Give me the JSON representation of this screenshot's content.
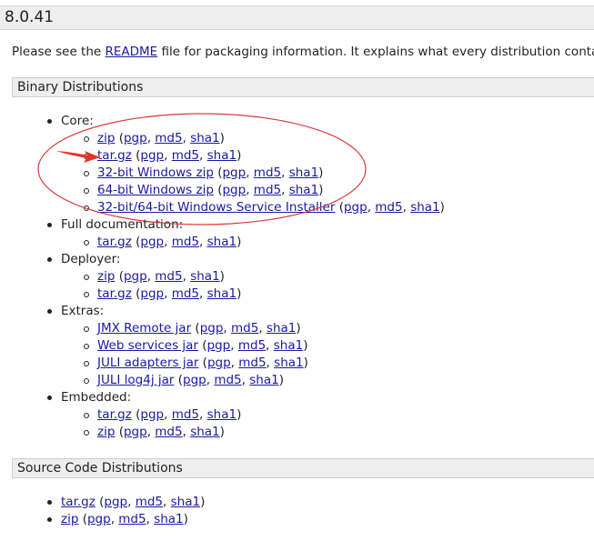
{
  "version": "8.0.41",
  "intro": {
    "before": "Please see the ",
    "link": "README",
    "after": " file for packaging information. It explains what every distribution contains."
  },
  "binary": {
    "title": "Binary Distributions",
    "core": {
      "label": "Core:",
      "items": [
        {
          "name": "zip",
          "sigs": [
            "pgp",
            "md5",
            "sha1"
          ]
        },
        {
          "name": "tar.gz",
          "sigs": [
            "pgp",
            "md5",
            "sha1"
          ]
        },
        {
          "name": "32-bit Windows zip",
          "sigs": [
            "pgp",
            "md5",
            "sha1"
          ]
        },
        {
          "name": "64-bit Windows zip",
          "sigs": [
            "pgp",
            "md5",
            "sha1"
          ]
        },
        {
          "name": "32-bit/64-bit Windows Service Installer",
          "sigs": [
            "pgp",
            "md5",
            "sha1"
          ]
        }
      ]
    },
    "fulldoc": {
      "label": "Full documentation:",
      "items": [
        {
          "name": "tar.gz",
          "sigs": [
            "pgp",
            "md5",
            "sha1"
          ]
        }
      ]
    },
    "deployer": {
      "label": "Deployer:",
      "items": [
        {
          "name": "zip",
          "sigs": [
            "pgp",
            "md5",
            "sha1"
          ]
        },
        {
          "name": "tar.gz",
          "sigs": [
            "pgp",
            "md5",
            "sha1"
          ]
        }
      ]
    },
    "extras": {
      "label": "Extras:",
      "items": [
        {
          "name": "JMX Remote jar",
          "sigs": [
            "pgp",
            "md5",
            "sha1"
          ]
        },
        {
          "name": "Web services jar",
          "sigs": [
            "pgp",
            "md5",
            "sha1"
          ]
        },
        {
          "name": "JULI adapters jar",
          "sigs": [
            "pgp",
            "md5",
            "sha1"
          ]
        },
        {
          "name": "JULI log4j jar",
          "sigs": [
            "pgp",
            "md5",
            "sha1"
          ]
        }
      ]
    },
    "embedded": {
      "label": "Embedded:",
      "items": [
        {
          "name": "tar.gz",
          "sigs": [
            "pgp",
            "md5",
            "sha1"
          ]
        },
        {
          "name": "zip",
          "sigs": [
            "pgp",
            "md5",
            "sha1"
          ]
        }
      ]
    }
  },
  "source": {
    "title": "Source Code Distributions",
    "items": [
      {
        "name": "tar.gz",
        "sigs": [
          "pgp",
          "md5",
          "sha1"
        ]
      },
      {
        "name": "zip",
        "sigs": [
          "pgp",
          "md5",
          "sha1"
        ]
      }
    ]
  },
  "annotation": {
    "stroke_color": "#d83a3a",
    "arrow_color": "#e8302a"
  }
}
